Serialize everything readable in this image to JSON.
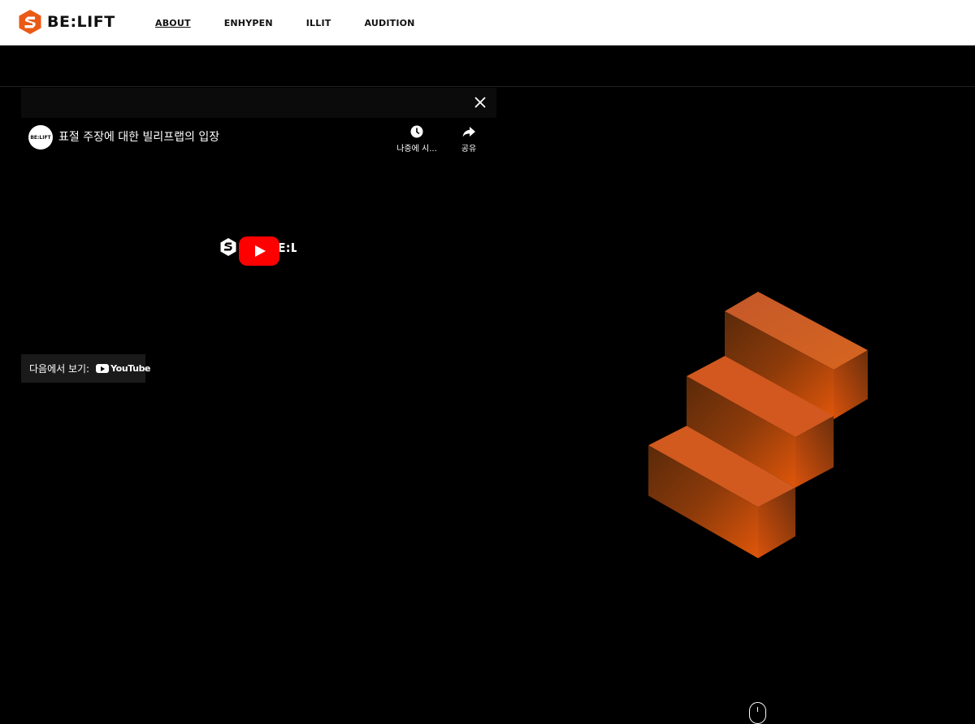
{
  "brand": {
    "name": "BE:LIFT",
    "accent": "#ea5a14"
  },
  "nav": {
    "items": [
      {
        "label": "ABOUT",
        "active": true
      },
      {
        "label": "ENHYPEN",
        "active": false
      },
      {
        "label": "ILLIT",
        "active": false
      },
      {
        "label": "AUDITION",
        "active": false
      }
    ]
  },
  "video": {
    "channel_avatar_text": "BE:LIFT",
    "title": "표절 주장에 대한 빌리프랩의 입장",
    "actions": [
      {
        "icon": "clock-icon",
        "label": "나중에 시..."
      },
      {
        "icon": "share-icon",
        "label": "공유"
      }
    ],
    "center_logo_text": "BE:LIFT",
    "watch_on_label": "다음에서 보기:",
    "youtube_wordmark": "YouTube",
    "close_icon": "close-icon",
    "play_color": "#ff0000"
  },
  "hero": {
    "illustration": "orange-staircase"
  },
  "scroll": {
    "icon": "mouse-scroll-icon"
  }
}
